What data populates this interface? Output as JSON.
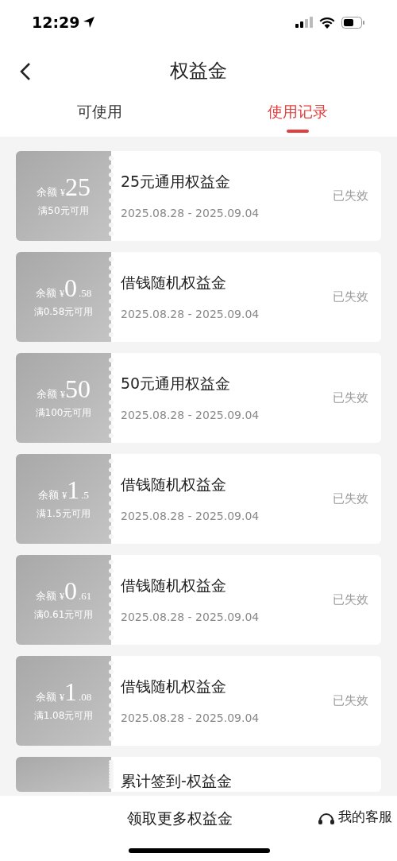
{
  "status_bar": {
    "time": "12:29"
  },
  "header": {
    "title": "权益金"
  },
  "tabs": [
    {
      "label": "可使用",
      "selected": false
    },
    {
      "label": "使用记录",
      "selected": true
    }
  ],
  "coupons": [
    {
      "balance_label": "余额",
      "currency": "¥",
      "amount_int": "25",
      "condition": "满50元可用",
      "title": "25元通用权益金",
      "period": "2025.08.28 - 2025.09.04",
      "status": "已失效"
    },
    {
      "balance_label": "余额",
      "currency": "¥",
      "amount_int": "0",
      "amount_dec": ".58",
      "condition": "满0.58元可用",
      "title": "借钱随机权益金",
      "period": "2025.08.28 - 2025.09.04",
      "status": "已失效"
    },
    {
      "balance_label": "余额",
      "currency": "¥",
      "amount_int": "50",
      "condition": "满100元可用",
      "title": "50元通用权益金",
      "period": "2025.08.28 - 2025.09.04",
      "status": "已失效"
    },
    {
      "balance_label": "余额",
      "currency": "¥",
      "amount_int": "1",
      "amount_dec": ".5",
      "condition": "满1.5元可用",
      "title": "借钱随机权益金",
      "period": "2025.08.28 - 2025.09.04",
      "status": "已失效"
    },
    {
      "balance_label": "余额",
      "currency": "¥",
      "amount_int": "0",
      "amount_dec": ".61",
      "condition": "满0.61元可用",
      "title": "借钱随机权益金",
      "period": "2025.08.28 - 2025.09.04",
      "status": "已失效"
    },
    {
      "balance_label": "余额",
      "currency": "¥",
      "amount_int": "1",
      "amount_dec": ".08",
      "condition": "满1.08元可用",
      "title": "借钱随机权益金",
      "period": "2025.08.28 - 2025.09.04",
      "status": "已失效"
    },
    {
      "title": "累计签到-权益金"
    }
  ],
  "bottom_bar": {
    "action": "领取更多权益金",
    "service": "我的客服"
  }
}
